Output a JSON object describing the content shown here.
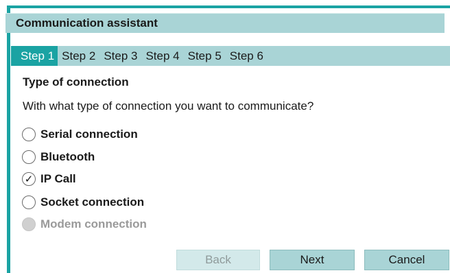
{
  "window": {
    "title": "Communication assistant"
  },
  "steps": [
    "Step 1",
    "Step 2",
    "Step 3",
    "Step 4",
    "Step 5",
    "Step 6"
  ],
  "active_step": "Step 1",
  "content": {
    "section_title": "Type of connection",
    "question": "With what type of connection you want to communicate?"
  },
  "options": [
    {
      "label": "Serial connection",
      "checked": false,
      "disabled": false
    },
    {
      "label": "Bluetooth",
      "checked": false,
      "disabled": false
    },
    {
      "label": "IP Call",
      "checked": true,
      "disabled": false
    },
    {
      "label": "Socket connection",
      "checked": false,
      "disabled": false
    },
    {
      "label": "Modem connection",
      "checked": false,
      "disabled": true
    }
  ],
  "buttons": {
    "back": "Back",
    "next": "Next",
    "cancel": "Cancel"
  },
  "colors": {
    "accent": "#1aa3a3",
    "panel": "#a9d4d6",
    "disabled_text": "#9a9a9a"
  },
  "icons": {
    "checked": "checkmark-icon"
  }
}
